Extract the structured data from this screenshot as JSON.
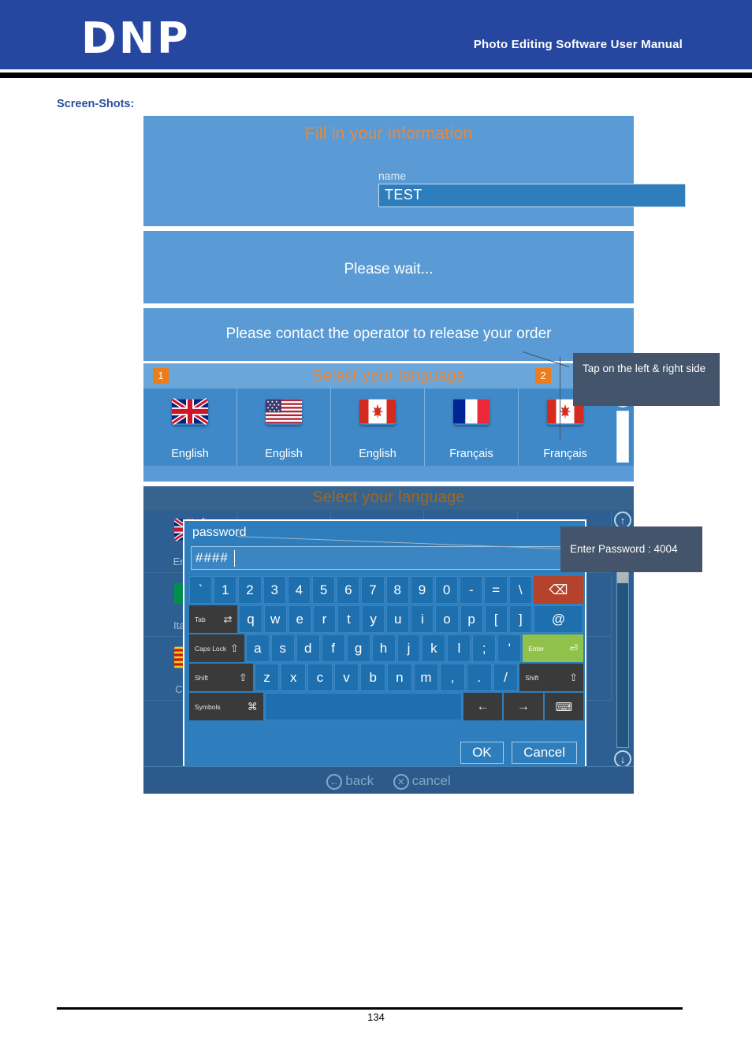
{
  "header": {
    "logo": "DNP",
    "manual_title": "Photo Editing Software User Manual",
    "brand_color": "#2647a0"
  },
  "section": {
    "label": "Screen-Shots:"
  },
  "screens": {
    "info": {
      "title": "Fill in your information",
      "field_label": "name",
      "field_value": "TEST",
      "title_color": "#e8883a",
      "bg_color": "#5b9bd5"
    },
    "wait": {
      "message": "Please wait..."
    },
    "language": {
      "contact_message": "Please contact the operator to release your order",
      "title": "Select your language",
      "badge_left": "1",
      "badge_right": "2",
      "badge_color": "#ed7d1b",
      "items": [
        {
          "flag": "flag-uk-icon",
          "label": "English"
        },
        {
          "flag": "flag-usa-icon",
          "label": "English"
        },
        {
          "flag": "flag-canada-icon",
          "label": "English"
        },
        {
          "flag": "flag-france-icon",
          "label": "Français"
        },
        {
          "flag": "flag-canada-icon",
          "label": "Français"
        }
      ],
      "scroll_up": "scroll-up-icon",
      "scroll_down": "scroll-down-icon"
    },
    "password_screen": {
      "title": "Select your language",
      "background_items": [
        {
          "flag": "flag-uk-icon",
          "label": "English"
        },
        {
          "flag": "flag-italy-icon",
          "label": "Italiano"
        },
        {
          "flag": "flag-catalonia-icon",
          "label": "Català"
        }
      ],
      "nav": {
        "back": "back",
        "cancel": "cancel"
      },
      "dialog": {
        "label": "password",
        "value": "####",
        "keyboard": {
          "row1": [
            "`",
            "1",
            "2",
            "3",
            "4",
            "5",
            "6",
            "7",
            "8",
            "9",
            "0",
            "-",
            "=",
            "\\"
          ],
          "backspace": "⌫",
          "row2_mod": {
            "label": "Tab",
            "glyph": "⇄"
          },
          "row2": [
            "q",
            "w",
            "e",
            "r",
            "t",
            "y",
            "u",
            "i",
            "o",
            "p",
            "[",
            "]"
          ],
          "row2_end": "@",
          "row3_mod": {
            "label": "Caps Lock",
            "glyph": "⇧"
          },
          "row3": [
            "a",
            "s",
            "d",
            "f",
            "g",
            "h",
            "j",
            "k",
            "l",
            ";",
            "'"
          ],
          "enter": {
            "label": "Enter",
            "glyph": "⏎"
          },
          "row4_mod": {
            "label": "Shift",
            "glyph": "⇧"
          },
          "row4": [
            "z",
            "x",
            "c",
            "v",
            "b",
            "n",
            "m",
            ",",
            ".",
            "/"
          ],
          "row4_mod_right": {
            "label": "Shift",
            "glyph": "⇧"
          },
          "row5_mod": {
            "label": "Symbols",
            "glyph": "⌘"
          },
          "space": "",
          "arrow_left": "←",
          "arrow_right": "→",
          "keyboard_toggle": "⌨"
        },
        "ok": "OK",
        "cancel": "Cancel"
      }
    }
  },
  "callouts": {
    "tap": "Tap on the left & right side",
    "password": "Enter Password : 4004",
    "color": "#44546a"
  },
  "footer": {
    "page_number": "134"
  }
}
